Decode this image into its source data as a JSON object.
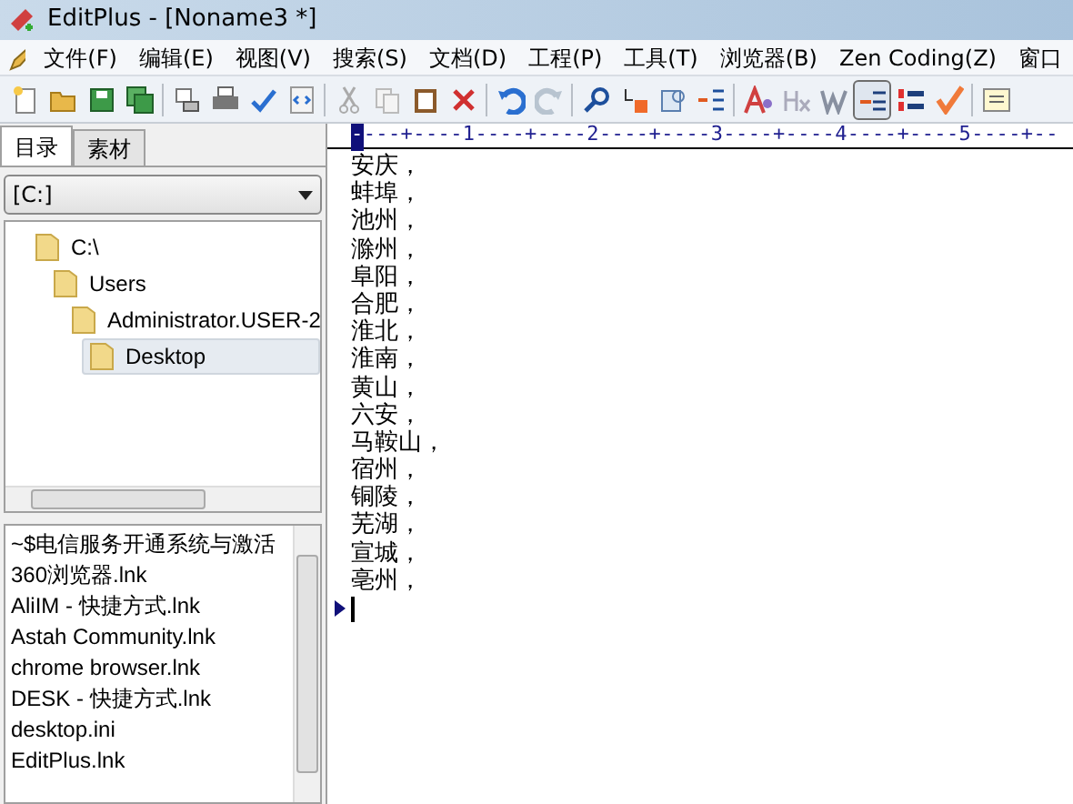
{
  "window": {
    "title": "EditPlus - [Noname3 *]"
  },
  "menu": [
    "文件(F)",
    "编辑(E)",
    "视图(V)",
    "搜索(S)",
    "文档(D)",
    "工程(P)",
    "工具(T)",
    "浏览器(B)",
    "Zen Coding(Z)",
    "窗口"
  ],
  "toolbar": [
    {
      "kind": "new"
    },
    {
      "kind": "open"
    },
    {
      "kind": "save"
    },
    {
      "kind": "save-all"
    },
    {
      "kind": "sep"
    },
    {
      "kind": "preview"
    },
    {
      "kind": "print"
    },
    {
      "kind": "spell"
    },
    {
      "kind": "browser"
    },
    {
      "kind": "sep"
    },
    {
      "kind": "cut"
    },
    {
      "kind": "copy"
    },
    {
      "kind": "paste"
    },
    {
      "kind": "delete"
    },
    {
      "kind": "sep"
    },
    {
      "kind": "undo"
    },
    {
      "kind": "redo"
    },
    {
      "kind": "sep"
    },
    {
      "kind": "find"
    },
    {
      "kind": "replace"
    },
    {
      "kind": "goto"
    },
    {
      "kind": "indent"
    },
    {
      "kind": "sep"
    },
    {
      "kind": "font"
    },
    {
      "kind": "hx"
    },
    {
      "kind": "wrap"
    },
    {
      "kind": "linenum",
      "pressed": true
    },
    {
      "kind": "columns"
    },
    {
      "kind": "check"
    },
    {
      "kind": "sep"
    },
    {
      "kind": "list"
    }
  ],
  "sidebar": {
    "tabs": [
      {
        "label": "目录",
        "selected": true
      },
      {
        "label": "素材",
        "selected": false
      }
    ],
    "drive": "[C:]",
    "tree": [
      {
        "label": "C:\\",
        "selected": false,
        "children": [
          {
            "label": "Users",
            "selected": false,
            "children": [
              {
                "label": "Administrator.USER-2",
                "selected": false,
                "children": [
                  {
                    "label": "Desktop",
                    "selected": true
                  }
                ]
              }
            ]
          }
        ]
      }
    ],
    "files": [
      "~$电信服务开通系统与激活",
      "360浏览器.lnk",
      "AliIM - 快捷方式.lnk",
      "Astah Community.lnk",
      "chrome browser.lnk",
      "DESK - 快捷方式.lnk",
      "desktop.ini",
      "EditPlus.lnk"
    ]
  },
  "editor": {
    "ruler": "----+----1----+----2----+----3----+----4----+----5----+--",
    "lines": [
      "安庆，",
      "蚌埠，",
      "池州，",
      "滁州，",
      "阜阳，",
      "合肥，",
      "淮北，",
      "淮南，",
      "黄山，",
      "六安，",
      "马鞍山，",
      "宿州，",
      "铜陵，",
      "芜湖，",
      "宣城，",
      "亳州，"
    ]
  }
}
